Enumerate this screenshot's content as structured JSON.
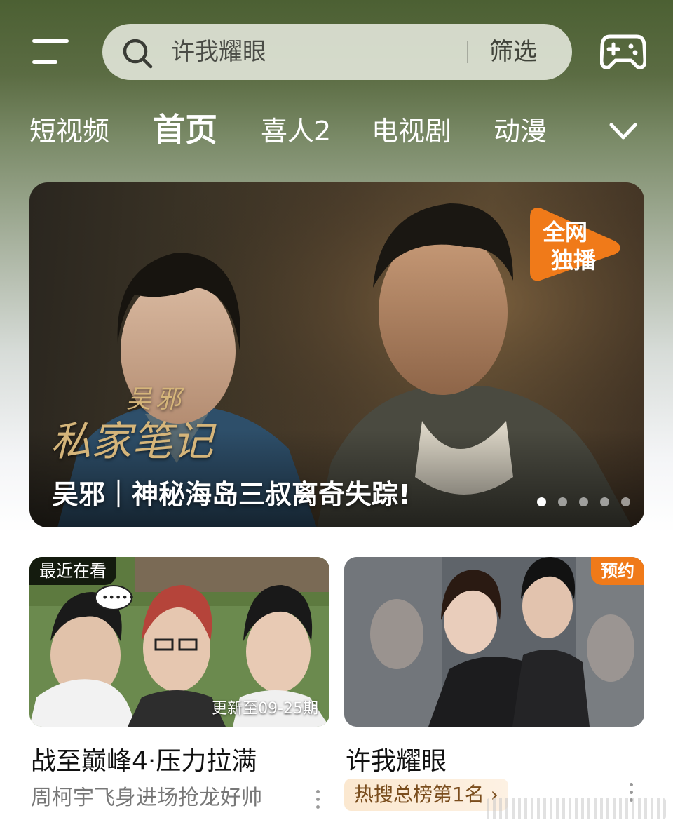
{
  "header": {
    "search_query": "许我耀眼",
    "filter_label": "筛选"
  },
  "tabs": [
    {
      "label": "短视频"
    },
    {
      "label": "首页",
      "active": true
    },
    {
      "label": "喜人2"
    },
    {
      "label": "电视剧"
    },
    {
      "label": "动漫"
    }
  ],
  "banner": {
    "calligraphy_line1": "吴邪",
    "calligraphy_line2": "私家笔记",
    "badge_line1": "全网",
    "badge_line2": "独播",
    "caption": "吴邪｜神秘海岛三叔离奇失踪!",
    "carousel": {
      "count": 5,
      "active_index": 0
    }
  },
  "cards": [
    {
      "tag": "最近在看",
      "episode_note": "更新至09-25期",
      "title": "战至巅峰4·压力拉满",
      "subtitle": "周柯宇飞身进场抢龙好帅"
    },
    {
      "tag": "预约",
      "title": "许我耀眼",
      "hot_label": "热搜总榜第1名 ›"
    }
  ],
  "colors": {
    "accent_orange": "#f07a19",
    "hot_pill_text": "#7a4d1d"
  }
}
